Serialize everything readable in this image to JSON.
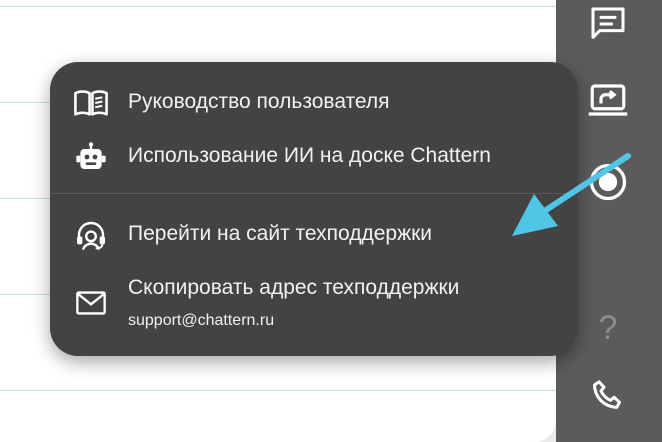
{
  "menu": {
    "items": [
      {
        "label": "Руководство пользователя",
        "icon": "book-open-icon"
      },
      {
        "label": "Использование ИИ на доске Chattern",
        "icon": "robot-icon"
      },
      {
        "label": "Перейти на сайт техподдержки",
        "icon": "headset-icon"
      },
      {
        "label": "Скопировать адрес техподдержки",
        "sub": "support@chattern.ru",
        "icon": "mail-icon"
      }
    ]
  },
  "toolbar": {
    "help_glyph": "?",
    "buttons": [
      "chat-icon",
      "screen-share-icon",
      "record-icon",
      "help-icon",
      "phone-icon"
    ]
  },
  "colors": {
    "menu_bg": "#434343",
    "toolbar_bg": "#5b5b5b",
    "annotation_arrow": "#4fc6e6"
  }
}
